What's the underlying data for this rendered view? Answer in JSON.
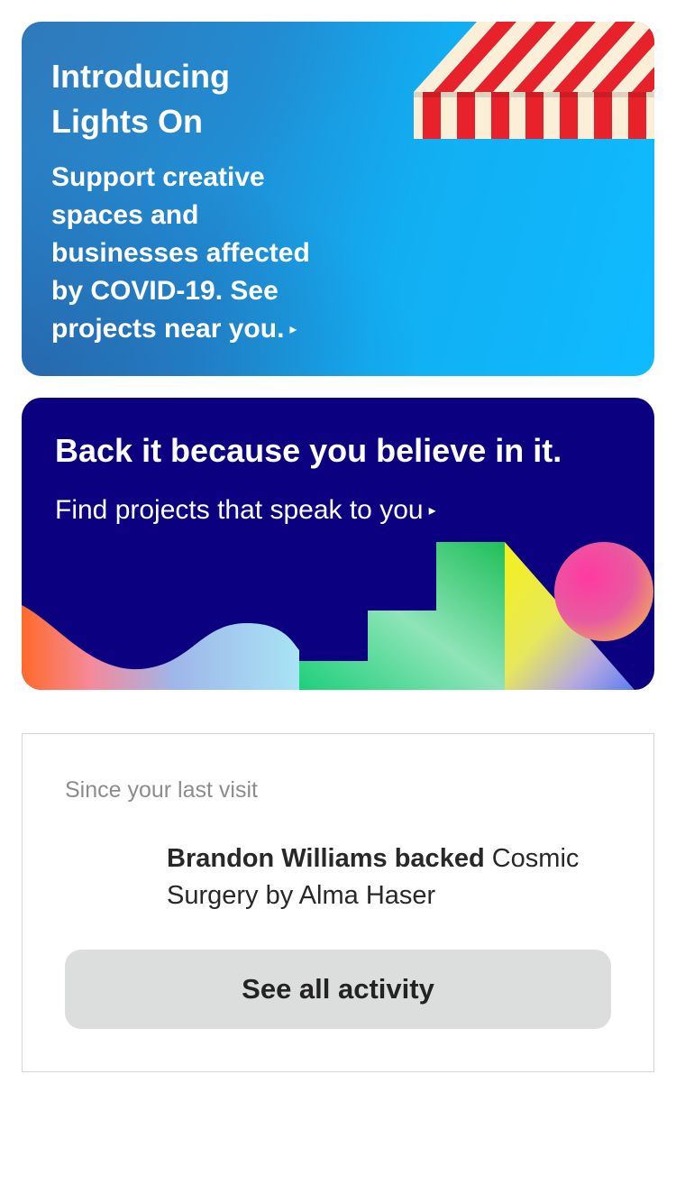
{
  "lights_on": {
    "title": "Introducing Lights On",
    "body": "Support creative spaces and businesses affected by COVID-19. See projects near you.",
    "arrow": "▸"
  },
  "back_it": {
    "title": "Back it because you believe in it.",
    "subtitle": "Find projects that speak to you",
    "arrow": "▸"
  },
  "activity": {
    "heading": "Since your last visit",
    "actor": "Brandon Williams backed",
    "project": "Cosmic Surgery by Alma Haser",
    "button_label": "See all activity"
  },
  "colors": {
    "lights_on_blue": "#1fa0e8",
    "back_it_navy": "#0b0080",
    "awning_red": "#e8222a",
    "awning_cream": "#fbefd8",
    "button_gray": "#dcdddd"
  }
}
